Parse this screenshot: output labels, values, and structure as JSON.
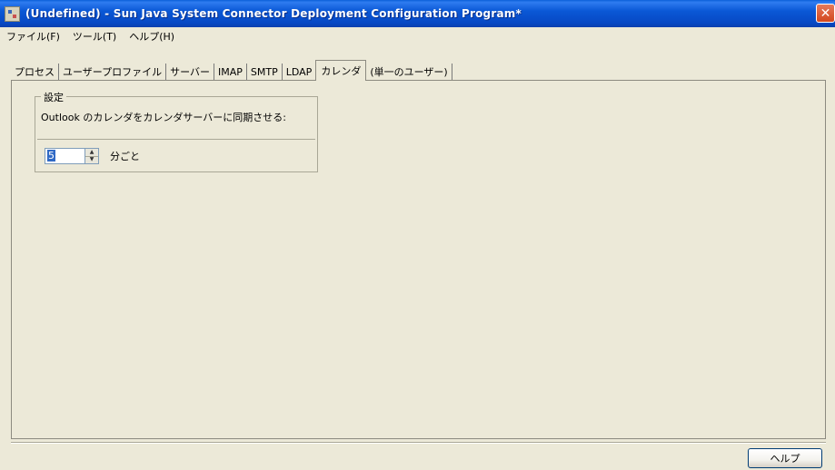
{
  "window": {
    "title": "(Undefined) - Sun Java System Connector Deployment Configuration Program*",
    "close_glyph": "✕",
    "title_color": "#0a58d6"
  },
  "menu": {
    "items": [
      {
        "label": "ファイル(F)"
      },
      {
        "label": "ツール(T)"
      },
      {
        "label": "ヘルプ(H)"
      }
    ]
  },
  "tabs": [
    {
      "label": "プロセス",
      "selected": false
    },
    {
      "label": "ユーザープロファイル",
      "selected": false
    },
    {
      "label": "サーバー",
      "selected": false
    },
    {
      "label": "IMAP",
      "selected": false
    },
    {
      "label": "SMTP",
      "selected": false
    },
    {
      "label": "LDAP",
      "selected": false
    },
    {
      "label": "カレンダ",
      "selected": true
    },
    {
      "label": "(単一のユーザー)",
      "selected": false
    }
  ],
  "settings_group": {
    "title": "設定",
    "description": "Outlook のカレンダをカレンダサーバーに同期させる:",
    "interval_value": "5",
    "interval_unit": "分ごと"
  },
  "buttons": {
    "help_label": "ヘルプ"
  },
  "icons": {
    "app": "app-icon",
    "close": "close-icon",
    "spin_up": "spin-up-icon",
    "spin_down": "spin-down-icon"
  }
}
